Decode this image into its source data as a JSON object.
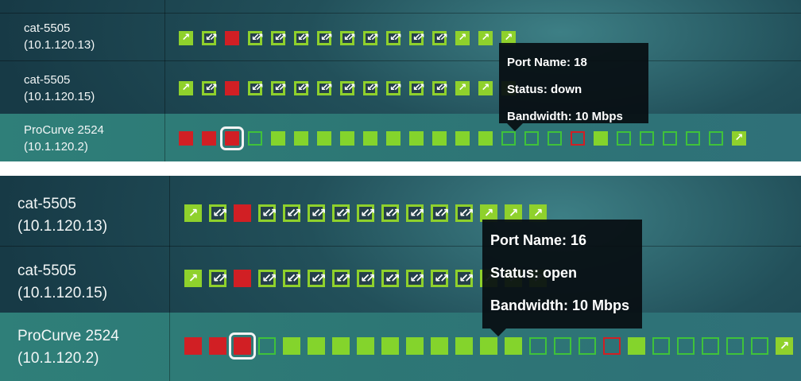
{
  "panels": [
    {
      "devices": [
        {
          "name": "cat-5505",
          "ip": "(10.1.120.13)",
          "ports": [
            "up-link",
            "trunk",
            "down",
            "trunk",
            "trunk",
            "trunk",
            "trunk",
            "trunk",
            "trunk",
            "trunk",
            "trunk",
            "trunk",
            "up-link",
            "up-link",
            "up-link"
          ]
        },
        {
          "name": "cat-5505",
          "ip": "(10.1.120.15)",
          "ports": [
            "up-link",
            "trunk",
            "down",
            "trunk",
            "trunk",
            "trunk",
            "trunk",
            "trunk",
            "trunk",
            "trunk",
            "trunk",
            "trunk",
            "up-link",
            "up-link",
            "up-link"
          ]
        },
        {
          "name": "ProCurve 2524",
          "ip": "(10.1.120.2)",
          "selected": true,
          "ports": [
            "down",
            "down",
            "down-selected",
            "open",
            "up",
            "up",
            "up",
            "up",
            "up",
            "up",
            "up",
            "up",
            "up",
            "up",
            "open",
            "open",
            "open",
            "down-outline",
            "up",
            "open",
            "open",
            "open",
            "open",
            "open",
            "up-link"
          ]
        }
      ],
      "tooltip": {
        "port_name": "Port Name: 18",
        "status": "Status: down",
        "bandwidth": "Bandwidth: 10 Mbps"
      }
    },
    {
      "devices": [
        {
          "name": "cat-5505",
          "ip": "(10.1.120.13)",
          "ports": [
            "up-link",
            "trunk",
            "down",
            "trunk",
            "trunk",
            "trunk",
            "trunk",
            "trunk",
            "trunk",
            "trunk",
            "trunk",
            "trunk",
            "up-link",
            "up-link",
            "up-link"
          ]
        },
        {
          "name": "cat-5505",
          "ip": "(10.1.120.15)",
          "ports": [
            "up-link",
            "trunk",
            "down",
            "trunk",
            "trunk",
            "trunk",
            "trunk",
            "trunk",
            "trunk",
            "trunk",
            "trunk",
            "trunk",
            "up-link",
            "up-link",
            "up-link"
          ]
        },
        {
          "name": "ProCurve 2524",
          "ip": "(10.1.120.2)",
          "selected": true,
          "ports": [
            "down",
            "down",
            "down-selected",
            "open",
            "up",
            "up",
            "up",
            "up",
            "up",
            "up",
            "up",
            "up",
            "up",
            "up",
            "open",
            "open",
            "open",
            "down-outline",
            "up",
            "open",
            "open",
            "open",
            "open",
            "open",
            "up-link"
          ]
        }
      ],
      "tooltip": {
        "port_name": "Port Name: 16",
        "status": "Status: open",
        "bandwidth": "Bandwidth: 10 Mbps"
      }
    }
  ],
  "colors": {
    "up": "#84d42c",
    "down": "#d11f24",
    "open": "#3fc23a",
    "selected_outline": "#f3f3f3"
  }
}
